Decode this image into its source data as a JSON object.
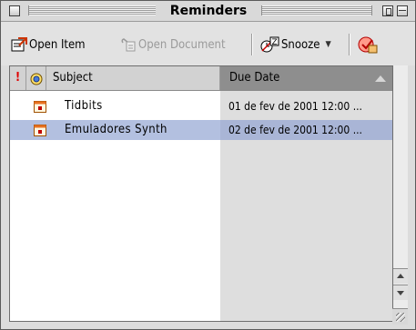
{
  "window": {
    "title": "Reminders"
  },
  "toolbar": {
    "open_item": "Open Item",
    "open_document": "Open Document",
    "snooze": "Snooze",
    "icons": [
      "open-item-icon",
      "open-document-icon",
      "snooze-icon",
      "scheduler-icon"
    ]
  },
  "table": {
    "headers": {
      "importance": "!",
      "subject": "Subject",
      "due_date": "Due Date"
    },
    "rows": [
      {
        "subject": "Tidbits",
        "due": "01 de fev de 2001 12:00 ...",
        "selected": false
      },
      {
        "subject": "Emuladores Synth",
        "due": "02 de fev de 2001 12:00 ...",
        "selected": true
      }
    ]
  },
  "colors": {
    "selection": "#b3c0e0",
    "header_sorted": "#8e8e8e",
    "importance": "#e00000"
  }
}
